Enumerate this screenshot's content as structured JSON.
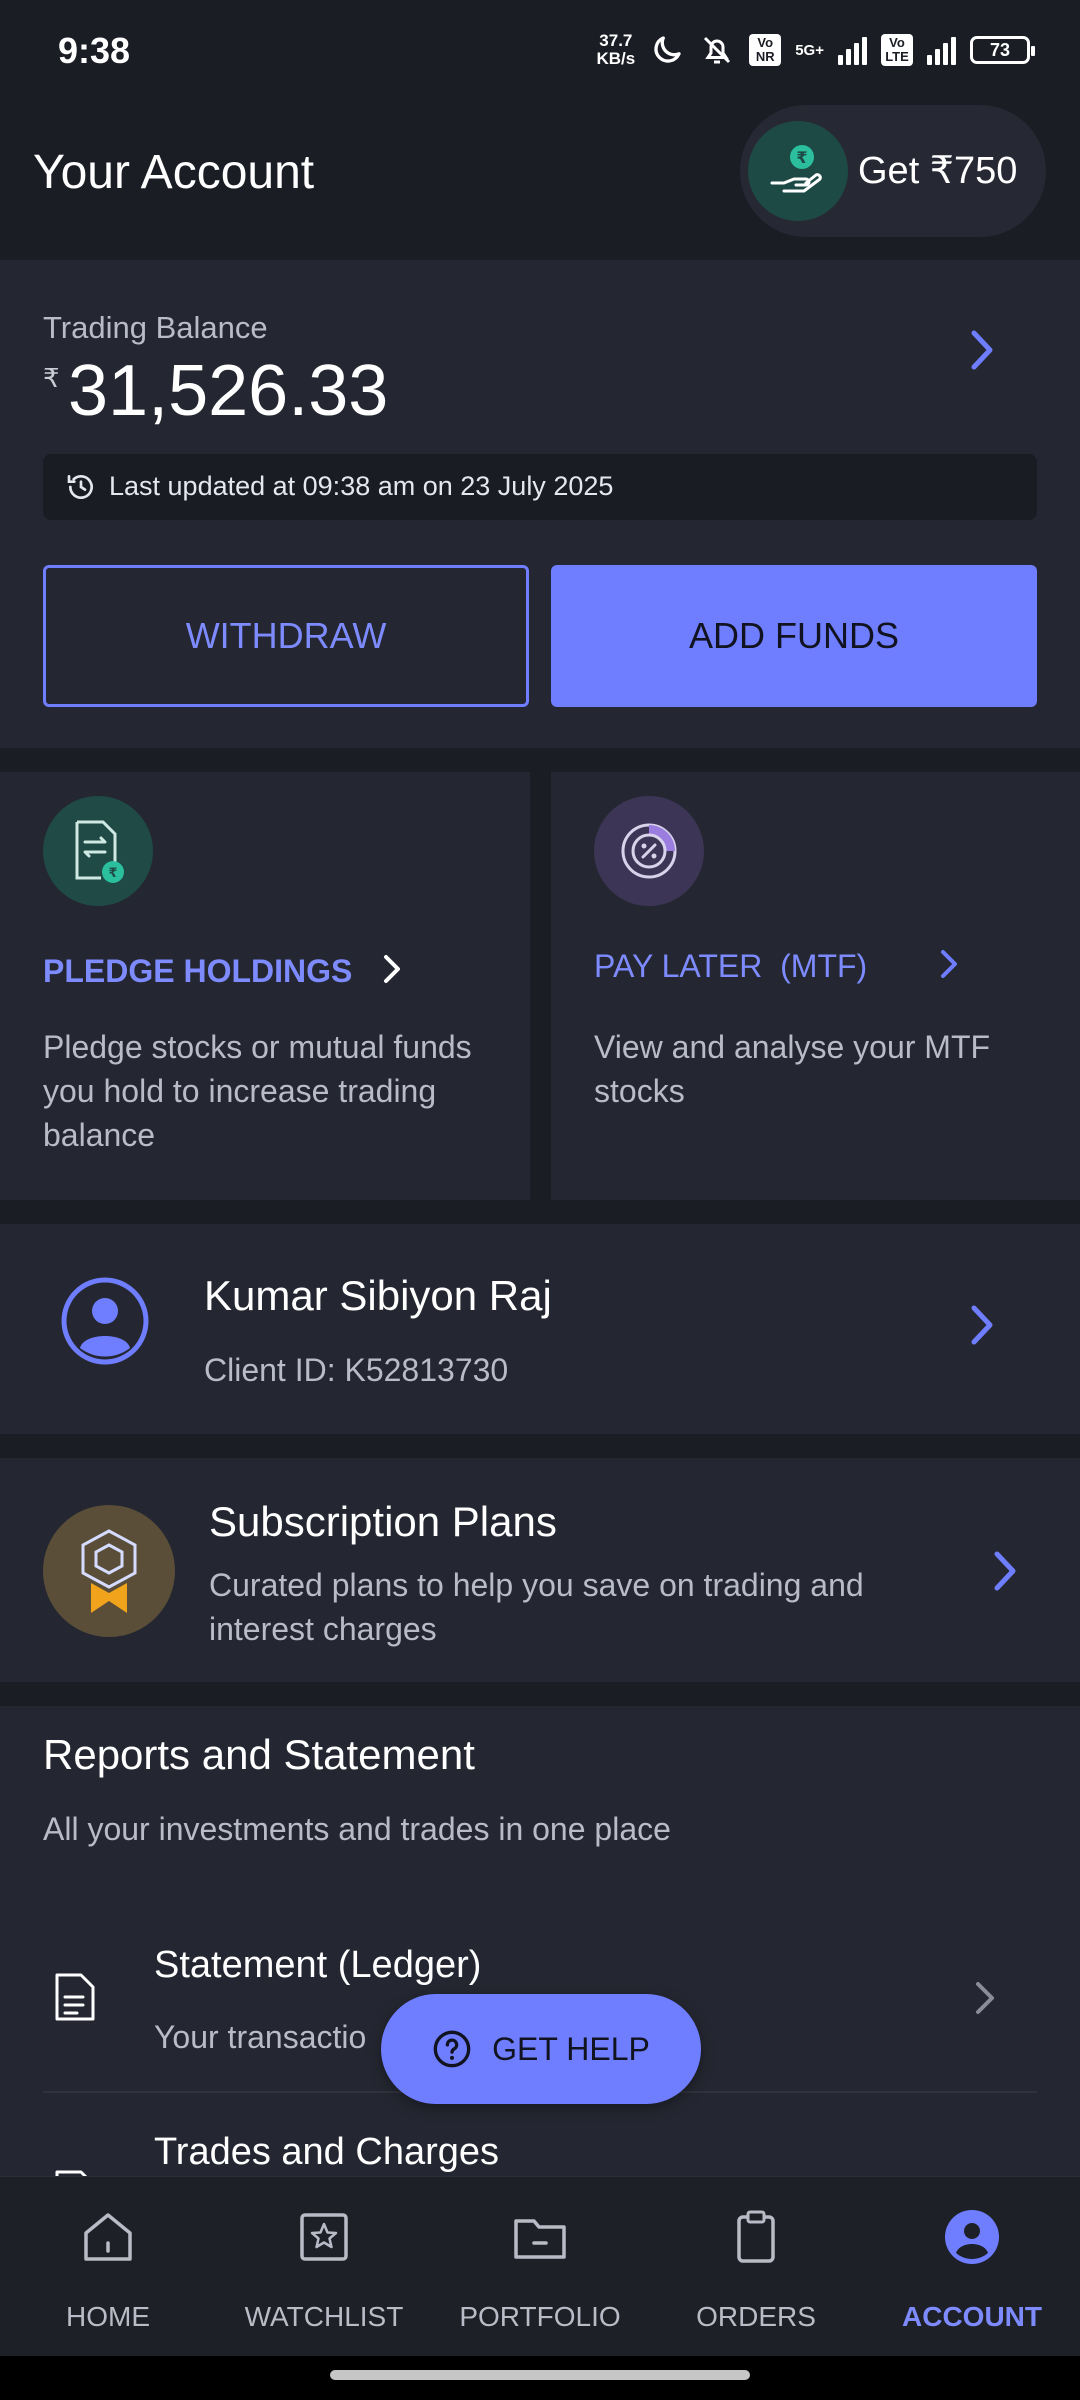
{
  "status_bar": {
    "time": "9:38",
    "net_speed_value": "37.7",
    "net_speed_unit": "KB/s",
    "sim1_tag": "Vo NR",
    "network_type": "5G+",
    "sim2_tag": "Vo LTE",
    "battery": "73"
  },
  "header": {
    "title": "Your Account",
    "referral_label": "Get ₹750"
  },
  "balance": {
    "label": "Trading Balance",
    "currency": "₹",
    "amount": "31,526.33",
    "last_updated": "Last updated at 09:38 am on 23 July 2025",
    "withdraw_label": "WITHDRAW",
    "add_funds_label": "ADD FUNDS"
  },
  "tiles": [
    {
      "title": "PLEDGE HOLDINGS",
      "description": "Pledge stocks or mutual funds you hold to increase trading balance"
    },
    {
      "title": "PAY LATER  (MTF)",
      "description": "View and analyse your MTF stocks"
    }
  ],
  "profile": {
    "name": "Kumar Sibiyon Raj",
    "client_id": "Client ID: K52813730"
  },
  "subscription": {
    "title": "Subscription Plans",
    "description": "Curated plans to help you save on trading and interest charges"
  },
  "reports": {
    "title": "Reports and Statement",
    "subtitle": "All your investments and trades in one place",
    "rows": [
      {
        "title": "Statement (Ledger)",
        "description": "Your transactio"
      },
      {
        "title": "Trades and Charges"
      }
    ]
  },
  "help_button": {
    "label": "GET HELP"
  },
  "bottom_nav": {
    "items": [
      {
        "label": "HOME",
        "icon": "home-icon",
        "active": false
      },
      {
        "label": "WATCHLIST",
        "icon": "star-icon",
        "active": false
      },
      {
        "label": "PORTFOLIO",
        "icon": "folder-icon",
        "active": false
      },
      {
        "label": "ORDERS",
        "icon": "clipboard-icon",
        "active": false
      },
      {
        "label": "ACCOUNT",
        "icon": "user-icon",
        "active": true
      }
    ]
  },
  "colors": {
    "background": "#1b1d25",
    "card": "#242731",
    "accent": "#6f7dff",
    "muted_text": "#b9bcc6"
  }
}
